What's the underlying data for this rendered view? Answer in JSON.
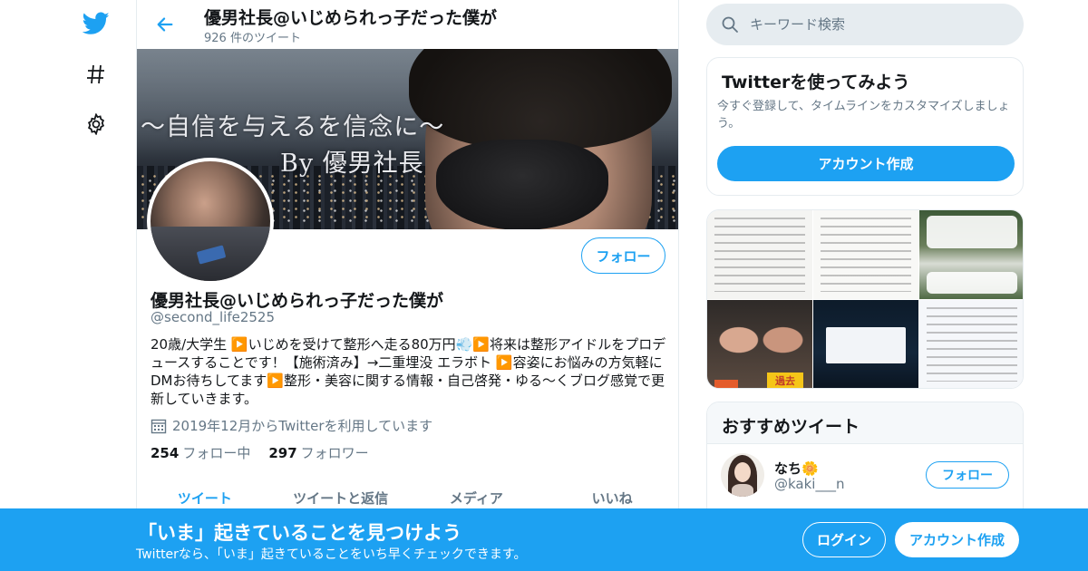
{
  "nav": {
    "twitter_icon": "twitter-bird-icon",
    "explore_icon": "hashtag-icon",
    "settings_icon": "gear-icon"
  },
  "header": {
    "title": "優男社長@いじめられっ子だった僕が",
    "tweet_count": "926 件のツイート"
  },
  "banner": {
    "tagline": "〜自信を与えるを信念に〜",
    "byline": "By 優男社長"
  },
  "profile": {
    "name": "優男社長@いじめられっ子だった僕が",
    "handle": "@second_life2525",
    "bio": "20歳/大学生 ▶️いじめを受けて整形へ走る80万円💨▶️将来は整形アイドルをプロデュースすることです！【施術済み】→二重埋没 エラボト ▶️容姿にお悩みの方気軽にDMお待ちしてます▶️整形・美容に関する情報・自己啓発・ゆる〜くブログ感覚で更新していきます。",
    "joined": "2019年12月からTwitterを利用しています",
    "following_count": "254",
    "following_label": "フォロー中",
    "followers_count": "297",
    "followers_label": "フォロワー",
    "follow_label": "フォロー"
  },
  "tabs": [
    {
      "label": "ツイート",
      "active": true
    },
    {
      "label": "ツイートと返信",
      "active": false
    },
    {
      "label": "メディア",
      "active": false
    },
    {
      "label": "いいね",
      "active": false
    }
  ],
  "search": {
    "placeholder": "キーワード検索"
  },
  "signup_card": {
    "title": "Twitterを使ってみよう",
    "text": "今すぐ登録して、タイムラインをカスタマイズしましょう。",
    "button": "アカウント作成"
  },
  "media_tiles": {
    "tag": "過去"
  },
  "recommend": {
    "title": "おすすめツイート",
    "user": {
      "name": "なち🌼",
      "handle": "@kaki___n",
      "follow_label": "フォロー"
    }
  },
  "bottom_bar": {
    "title": "「いま」起きていることを見つけよう",
    "text": "Twitterなら、「いま」起きていることをいち早くチェックできます。",
    "login": "ログイン",
    "signup": "アカウント作成"
  },
  "colors": {
    "accent": "#1da1f2",
    "text": "#14171a",
    "muted": "#657786",
    "border": "#e6ecf0"
  }
}
